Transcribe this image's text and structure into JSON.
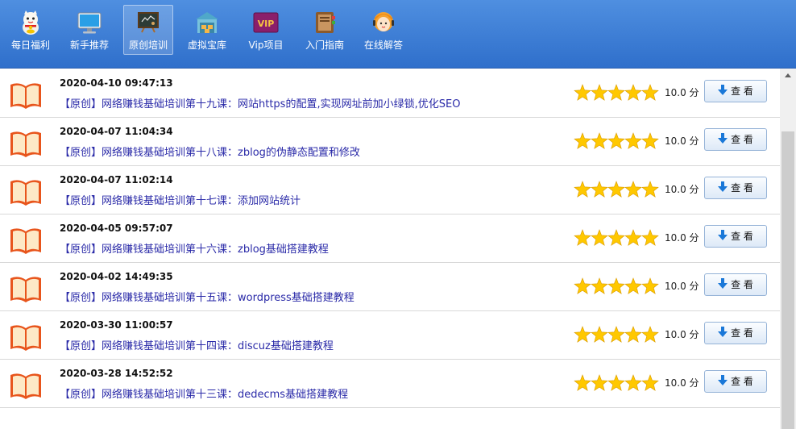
{
  "toolbar": {
    "items": [
      {
        "label": "每日福利",
        "icon": "lucky-cat-icon"
      },
      {
        "label": "新手推荐",
        "icon": "monitor-icon"
      },
      {
        "label": "原创培训",
        "icon": "blackboard-icon",
        "active": true
      },
      {
        "label": "虚拟宝库",
        "icon": "warehouse-icon"
      },
      {
        "label": "Vip项目",
        "icon": "vip-icon",
        "icon_text": "VIP"
      },
      {
        "label": "入门指南",
        "icon": "guide-book-icon"
      },
      {
        "label": "在线解答",
        "icon": "support-agent-icon"
      }
    ]
  },
  "list": {
    "rows": [
      {
        "date": "2020-04-10 09:47:13",
        "title": "【原创】网络赚钱基础培训第十九课：网站https的配置,实现网址前加小绿锁,优化SEO",
        "rating": 5,
        "score": "10.0 分",
        "button": "查 看"
      },
      {
        "date": "2020-04-07 11:04:34",
        "title": "【原创】网络赚钱基础培训第十八课：zblog的伪静态配置和修改",
        "rating": 5,
        "score": "10.0 分",
        "button": "查 看"
      },
      {
        "date": "2020-04-07 11:02:14",
        "title": "【原创】网络赚钱基础培训第十七课：添加网站统计",
        "rating": 5,
        "score": "10.0 分",
        "button": "查 看"
      },
      {
        "date": "2020-04-05 09:57:07",
        "title": "【原创】网络赚钱基础培训第十六课：zblog基础搭建教程",
        "rating": 5,
        "score": "10.0 分",
        "button": "查 看"
      },
      {
        "date": "2020-04-02 14:49:35",
        "title": "【原创】网络赚钱基础培训第十五课：wordpress基础搭建教程",
        "rating": 5,
        "score": "10.0 分",
        "button": "查 看"
      },
      {
        "date": "2020-03-30 11:00:57",
        "title": "【原创】网络赚钱基础培训第十四课：discuz基础搭建教程",
        "rating": 5,
        "score": "10.0 分",
        "button": "查 看"
      },
      {
        "date": "2020-03-28 14:52:52",
        "title": "【原创】网络赚钱基础培训第十三课：dedecms基础搭建教程",
        "rating": 5,
        "score": "10.0 分",
        "button": "查 看"
      }
    ]
  },
  "colors": {
    "toolbar": "#3b7bd6",
    "title_link": "#2a2aa8",
    "star": "#ffc800",
    "book": "#e8551c",
    "download_arrow": "#1a78d8"
  }
}
